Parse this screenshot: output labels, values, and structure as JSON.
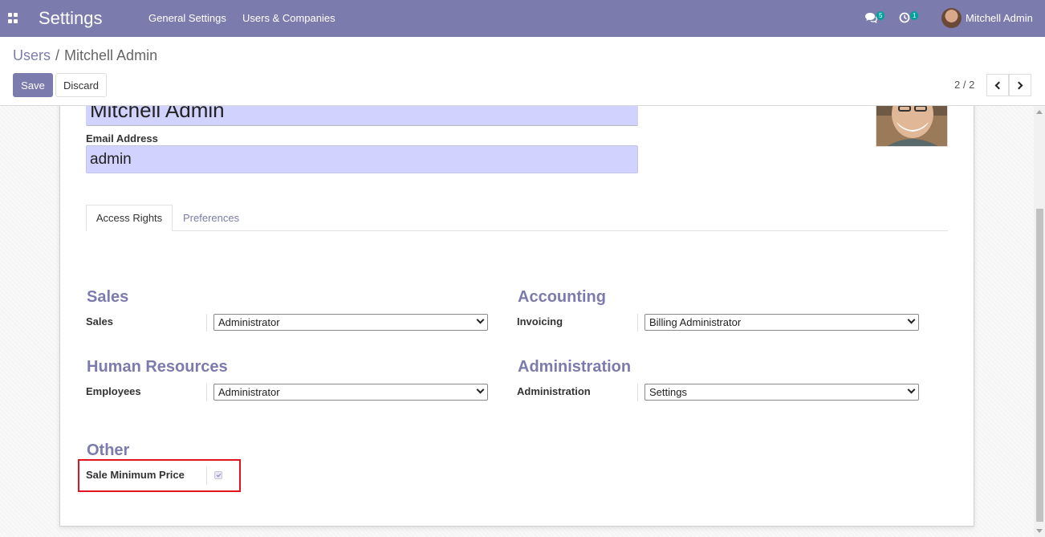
{
  "navbar": {
    "app_title": "Settings",
    "menus": [
      "General Settings",
      "Users & Companies"
    ],
    "messages_badge": "5",
    "activities_badge": "1",
    "user_name": "Mitchell Admin",
    "bg_color": "#7c7bad"
  },
  "breadcrumb": {
    "parent": "Users",
    "separator": "/",
    "current": "Mitchell Admin"
  },
  "buttons": {
    "save": "Save",
    "discard": "Discard"
  },
  "pager": {
    "value": "2 / 2"
  },
  "form": {
    "name": "Mitchell Admin",
    "email_label": "Email Address",
    "email_value": "admin",
    "tabs": [
      {
        "label": "Access Rights",
        "active": true
      },
      {
        "label": "Preferences",
        "active": false
      }
    ],
    "groups": [
      {
        "title": "Sales",
        "label": "Sales",
        "value": "Administrator"
      },
      {
        "title": "Accounting",
        "label": "Invoicing",
        "value": "Billing Administrator"
      },
      {
        "title": "Human Resources",
        "label": "Employees",
        "value": "Administrator"
      },
      {
        "title": "Administration",
        "label": "Administration",
        "value": "Settings"
      }
    ],
    "other": {
      "title": "Other",
      "label": "Sale Minimum Price",
      "checked": true
    }
  },
  "colors": {
    "accent": "#7c7bad",
    "field_bg": "#d2d2ff",
    "highlight": "#e0141e"
  }
}
